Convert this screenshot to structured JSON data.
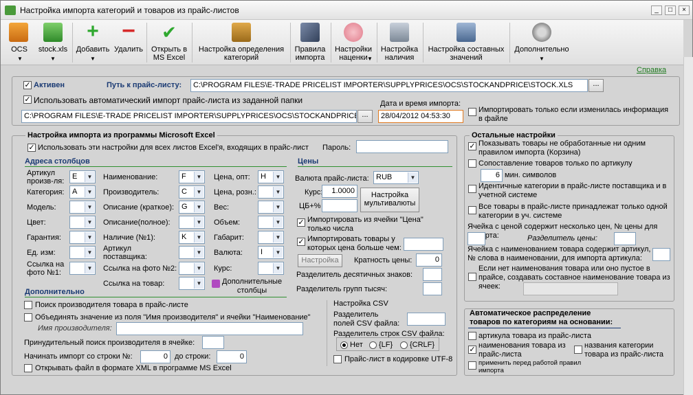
{
  "window": {
    "title": "Настройка импорта категорий и товаров из прайс-листов"
  },
  "toolbar": [
    {
      "id": "ocs",
      "label": "OCS",
      "dropdown": true,
      "icon": "truck-icon"
    },
    {
      "id": "stock",
      "label": "stock.xls",
      "dropdown": true,
      "icon": "excel-file-icon"
    },
    {
      "id": "add",
      "label": "Добавить",
      "dropdown": true,
      "icon": "plus-icon"
    },
    {
      "id": "del",
      "label": "Удалить",
      "dropdown": false,
      "icon": "minus-icon"
    },
    {
      "id": "open",
      "label": "Открыть в\nMS Excel",
      "dropdown": false,
      "icon": "checkmark-icon"
    },
    {
      "id": "catdef",
      "label": "Настройка определения\nкатегорий",
      "dropdown": false,
      "icon": "categories-icon"
    },
    {
      "id": "rules",
      "label": "Правила\nимпорта",
      "dropdown": false,
      "icon": "pen-icon"
    },
    {
      "id": "markup",
      "label": "Настройки\nнаценки",
      "dropdown": true,
      "icon": "piggy-bank-icon"
    },
    {
      "id": "avail",
      "label": "Настройка\nналичия",
      "dropdown": false,
      "icon": "cart-icon"
    },
    {
      "id": "compname",
      "label": "Настройка составных\nзначений",
      "dropdown": false,
      "icon": "keyboard-icon"
    },
    {
      "id": "more",
      "label": "Дополнительно",
      "dropdown": true,
      "icon": "gear-icon"
    }
  ],
  "help_link": "Справка",
  "top": {
    "active_label": "Активен",
    "path_label": "Путь к прайс-листу:",
    "path_value": "C:\\PROGRAM FILES\\E-TRADE PRICELIST IMPORTER\\SUPPLYPRICES\\OCS\\STOCKANDPRICE\\STOCK.XLS",
    "auto_label": "Использовать автоматический импорт прайс-листа из заданной папки",
    "folder_value": "C:\\PROGRAM FILES\\E-TRADE PRICELIST IMPORTER\\SUPPLYPRICES\\OCS\\STOCKANDPRICE\\",
    "datetime_label": "Дата и время импорта:",
    "datetime_value": "28/04/2012 04:53:30",
    "only_changed_label": "Импортировать только если изменилась информация в файле",
    "browse": "..."
  },
  "excel": {
    "title": "Настройка импорта из программы Microsoft Excel",
    "all_sheets_label": "Использовать эти настройки для всех листов Excel'я, входящих в прайс-лист",
    "password_label": "Пароль:",
    "cols_title": "Адреса столбцов",
    "cols": [
      {
        "label": "Артикул\nпроизв-ля:",
        "value": "E"
      },
      {
        "label": "Категория:",
        "value": "A"
      },
      {
        "label": "Модель:",
        "value": ""
      },
      {
        "label": "Цвет:",
        "value": ""
      },
      {
        "label": "Гарантия:",
        "value": ""
      },
      {
        "label": "Ед. изм:",
        "value": ""
      },
      {
        "label": "Ссылка на\nфото №1:",
        "value": ""
      }
    ],
    "cols2": [
      {
        "label": "Наименование:",
        "value": "F"
      },
      {
        "label": "Производитель:",
        "value": "C"
      },
      {
        "label": "Описание (краткое):",
        "value": "G"
      },
      {
        "label": "Описание(полное):",
        "value": ""
      },
      {
        "label": "Наличие (№1):",
        "value": "K"
      },
      {
        "label": "Артикул\nпоставщика:",
        "value": ""
      },
      {
        "label": "Ссылка на фото №2:",
        "value": ""
      },
      {
        "label": "Ссылка на товар:",
        "value": ""
      }
    ],
    "cols3": [
      {
        "label": "Цена, опт:",
        "value": "H"
      },
      {
        "label": "Цена, розн.:",
        "value": ""
      },
      {
        "label": "Вес:",
        "value": ""
      },
      {
        "label": "Объем:",
        "value": ""
      },
      {
        "label": "Габарит:",
        "value": ""
      },
      {
        "label": "Валюта:",
        "value": "I"
      },
      {
        "label": "Курс:",
        "value": ""
      }
    ],
    "extra_cols": "Дополнительные\nстолбцы",
    "prices_title": "Цены",
    "currency_label": "Валюта прайс-листа:",
    "currency_value": "RUB",
    "rate_label": "Курс:",
    "rate_value": "1.0000",
    "cb_label": "ЦБ+%",
    "multicurrency_btn": "Настройка\nмультивалюты",
    "import_from_price_label": "Импортировать из ячейки \"Цена\"\nтолько числа",
    "import_price_greater_label": "Импортировать товары у\nкоторых цена больше чем:",
    "settings_btn": "Настройка",
    "price_mult_label": "Кратность цены:",
    "price_mult_value": "0",
    "dec_sep_label": "Разделитель десятичных знаков:",
    "group_sep_label": "Разделитель групп тысяч:",
    "extra_title": "Дополнительно",
    "search_maker_label": "Поиск производителя товара в прайс-листе",
    "merge_label": "Объединять значение из поля \"Имя производителя\" и ячейки \"Наименование\"",
    "maker_name_label": "Имя производителя:",
    "forced_search_label": "Принудительный поиск производителя в ячейке:",
    "start_row_label": "Начинать импорт со строки №:",
    "start_row_value": "0",
    "to_row_label": "до строки:",
    "to_row_value": "0",
    "xml_label": "Открывать файл в формате XML в программе MS Excel",
    "csv_title": "Настройка CSV",
    "csv_field_sep": "Разделитель\nполей CSV файла:",
    "csv_row_sep": "Разделитель строк CSV файла:",
    "csv_opts": [
      "Нет",
      "{LF}",
      "{CRLF}"
    ],
    "utf8_label": "Прайс-лист в кодировке UTF-8"
  },
  "other": {
    "title": "Остальные настройки",
    "show_unprocessed": "Показывать товары не обработанные ни одним правилом импорта (Корзина)",
    "match_article": "Сопоставление товаров только по артикулу",
    "min_chars_value": "6",
    "min_chars_label": "мин. символов",
    "identical_cats": "Идентичные категории в прайс-листе поставщика и в учетной системе",
    "all_goods_belong": "Все товары в прайс-листе принадлежат только одной категории в уч. системе",
    "multi_prices": "Ячейка с ценой содержит несколько цен, № цены для импорта:",
    "price_sep": "Разделитель цены:",
    "name_contains": "Ячейка с наименованием товара содержит артикул, № слова в наименовании, для импорта артикула:",
    "no_name": "Если нет наименования товара или оно пустое в прайсе, создавать составное наименование товара из ячеек:"
  },
  "auto": {
    "title": "Автоматическое распределение\nтоваров по категориям на основании:",
    "by_article": "артикула товара из прайс-листа",
    "by_name": "наименования товара из\nпрайс-листа",
    "by_catname": "названия  категории\nтовара из прайс-листа",
    "apply_before": "применить перед работой правил\nимпорта"
  }
}
